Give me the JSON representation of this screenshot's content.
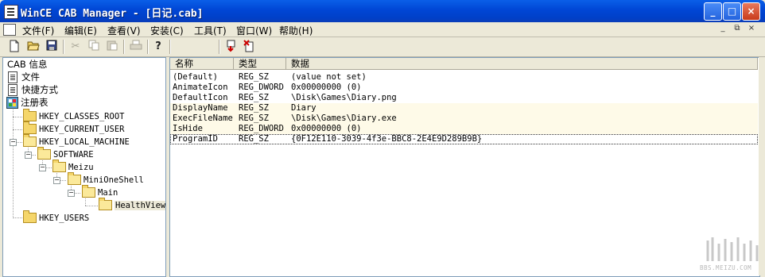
{
  "window": {
    "title": "WinCE CAB Manager - [日记.cab]",
    "controls": [
      "_",
      "□",
      "×"
    ]
  },
  "menu": {
    "items": [
      "文件(F)",
      "编辑(E)",
      "查看(V)",
      "安装(C)",
      "工具(T)",
      "窗口(W)",
      "帮助(H)"
    ],
    "mdi_controls": [
      "_",
      "⧉",
      "×"
    ]
  },
  "toolbar": {
    "buttons": [
      "new-file-icon",
      "open-folder-icon",
      "save-icon",
      "cut-icon",
      "copy-icon",
      "paste-icon",
      "print-icon",
      "help-icon",
      "insert-icon",
      "delete-icon"
    ]
  },
  "tree": {
    "root": "CAB 信息",
    "files": "文件",
    "shortcuts": "快捷方式",
    "registry": "注册表",
    "keys": {
      "classes_root": "HKEY_CLASSES_ROOT",
      "current_user": "HKEY_CURRENT_USER",
      "local_machine": "HKEY_LOCAL_MACHINE",
      "software": "SOFTWARE",
      "meizu": "Meizu",
      "minioneshell": "MiniOneShell",
      "main": "Main",
      "healthview": "HealthView",
      "users": "HKEY_USERS"
    }
  },
  "list": {
    "columns": [
      "名称",
      "类型",
      "数据"
    ],
    "rows": [
      {
        "name": "(Default)",
        "type": "REG_SZ",
        "data": "(value not set)"
      },
      {
        "name": "AnimateIcon",
        "type": "REG_DWORD",
        "data": "0x00000000 (0)"
      },
      {
        "name": "DefaultIcon",
        "type": "REG_SZ",
        "data": "\\Disk\\Games\\Diary.png"
      },
      {
        "name": "DisplayName",
        "type": "REG_SZ",
        "data": "Diary"
      },
      {
        "name": "ExecFileName",
        "type": "REG_SZ",
        "data": "\\Disk\\Games\\Diary.exe"
      },
      {
        "name": "IsHide",
        "type": "REG_DWORD",
        "data": "0x00000000 (0)"
      },
      {
        "name": "ProgramID",
        "type": "REG_SZ",
        "data": "{0F12E110-3039-4f3e-BBC8-2E4E9D289B9B}"
      }
    ]
  },
  "watermark": {
    "text": "BBS.MEIZU.COM"
  }
}
